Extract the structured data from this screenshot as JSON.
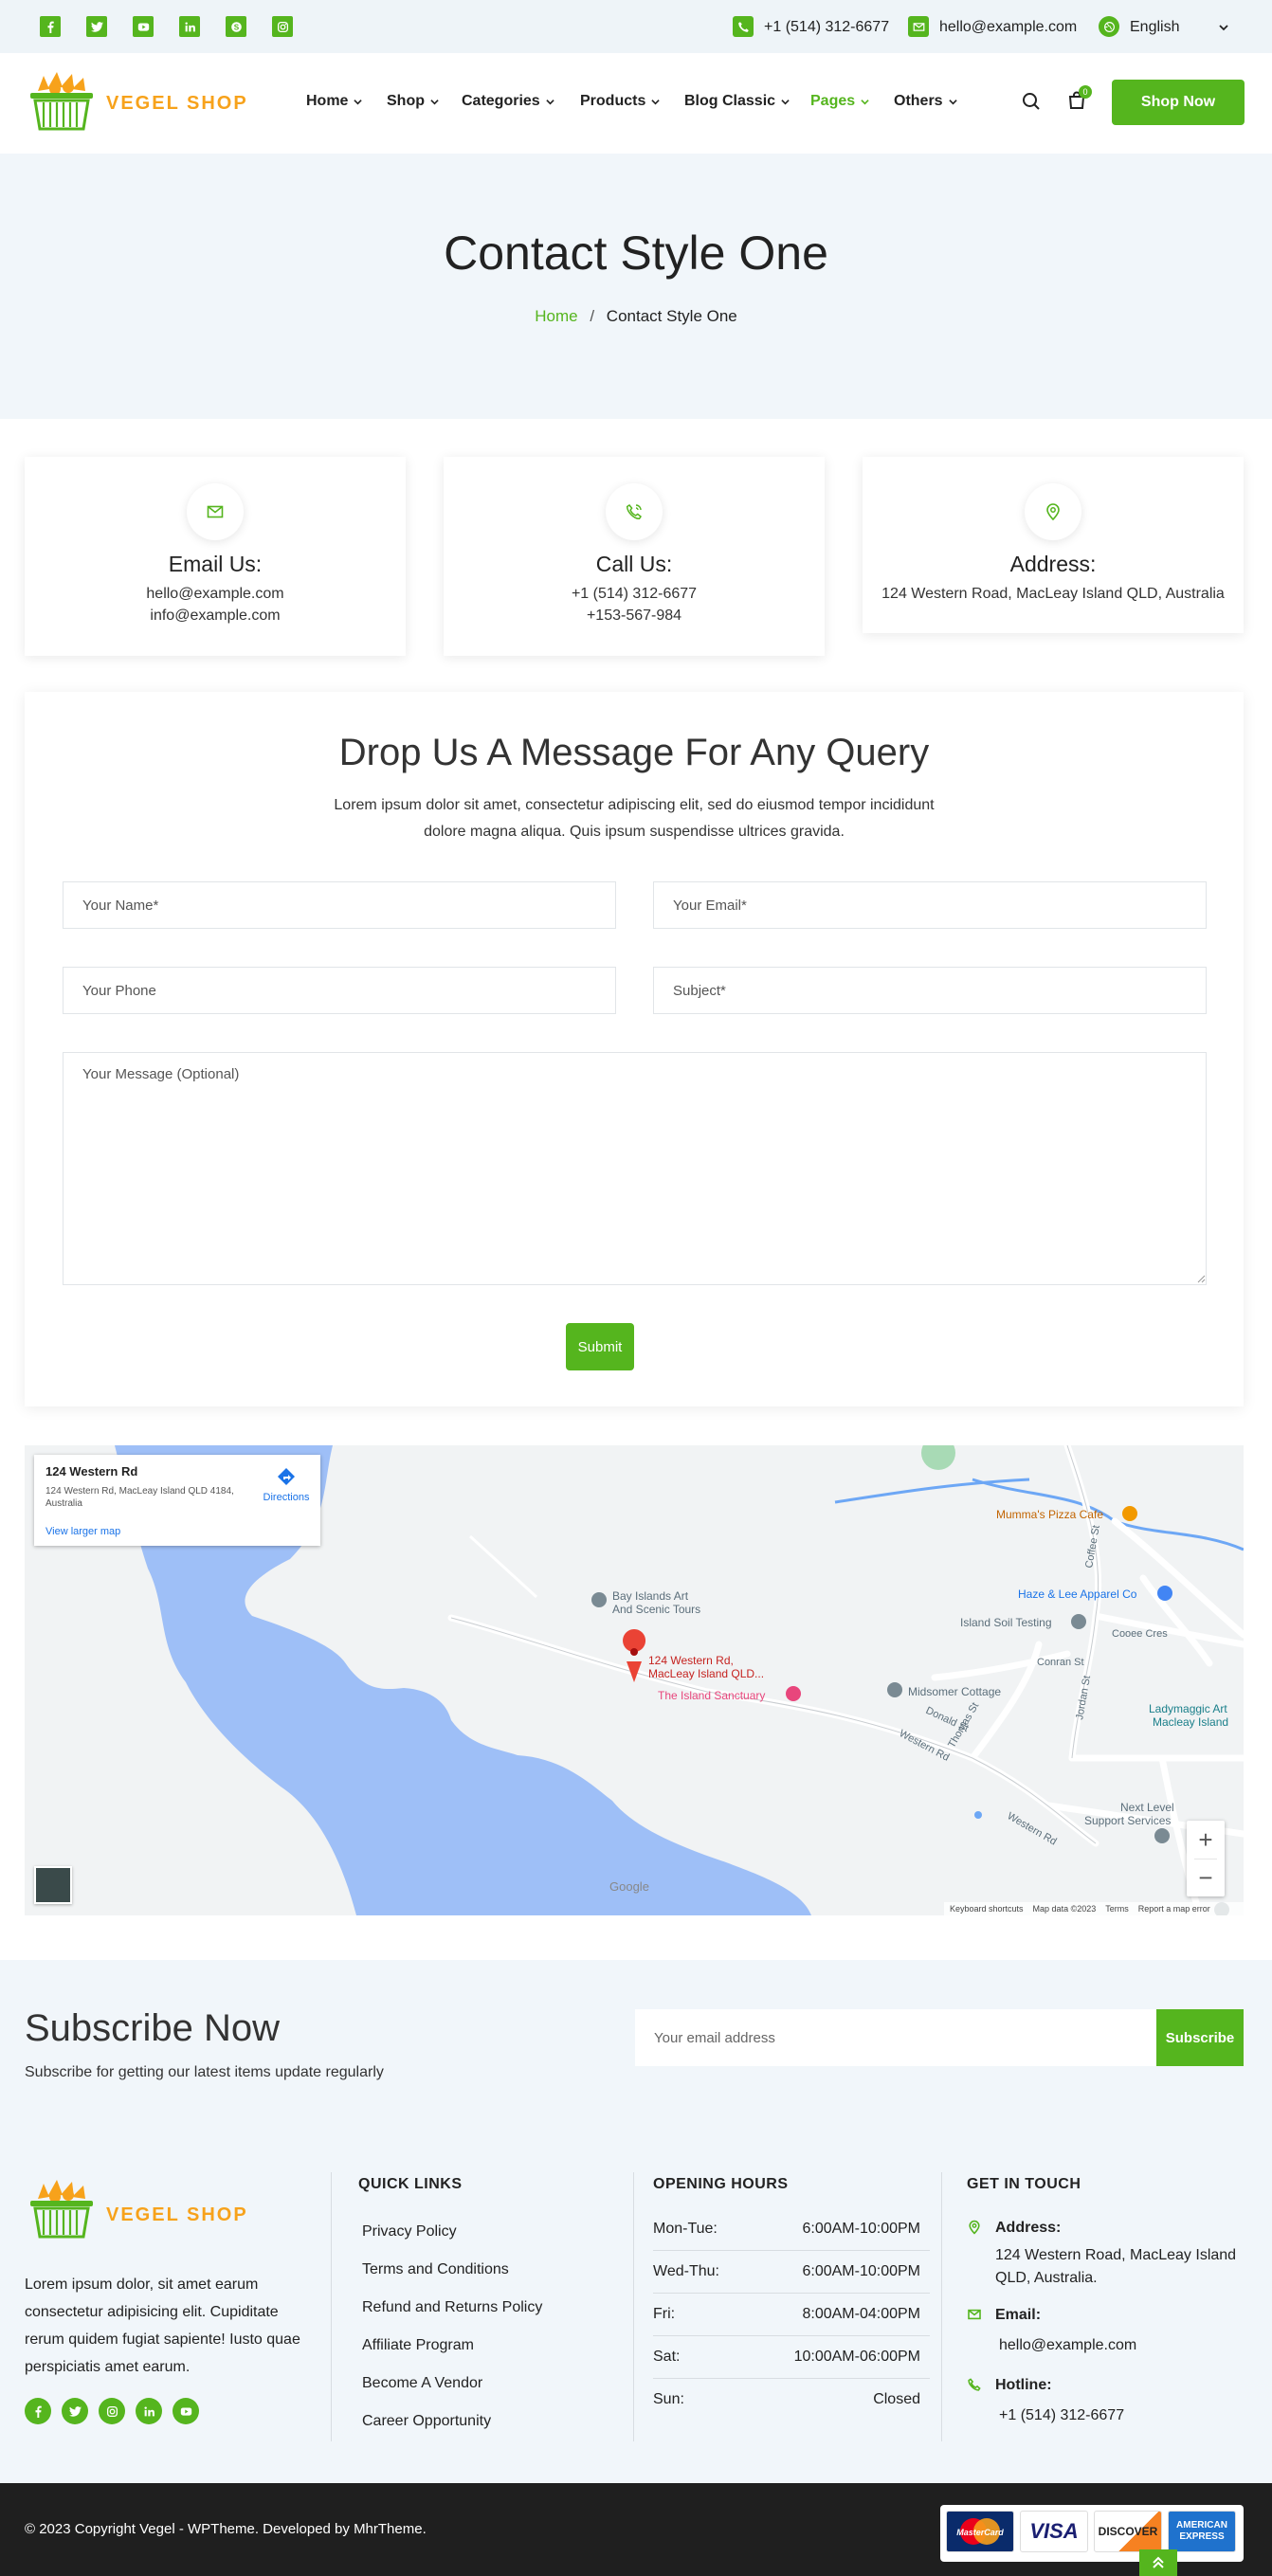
{
  "topbar": {
    "phone": "+1 (514) 312-6677",
    "email": "hello@example.com",
    "language": "English"
  },
  "header": {
    "brand": "VEGEL SHOP",
    "nav": [
      {
        "label": "Home",
        "active": false
      },
      {
        "label": "Shop",
        "active": false
      },
      {
        "label": "Categories",
        "active": false
      },
      {
        "label": "Products",
        "active": false
      },
      {
        "label": "Blog Classic",
        "active": false
      },
      {
        "label": "Pages",
        "active": true
      },
      {
        "label": "Others",
        "active": false
      }
    ],
    "cart_count": "0",
    "cta": "Shop Now"
  },
  "hero": {
    "title": "Contact Style One",
    "breadcrumb_home": "Home",
    "breadcrumb_sep": "/",
    "breadcrumb_current": "Contact Style One"
  },
  "info_cards": {
    "email": {
      "title": "Email Us:",
      "line1": "hello@example.com",
      "line2": "info@example.com"
    },
    "call": {
      "title": "Call Us:",
      "line1": "+1 (514) 312-6677",
      "line2": "+153-567-984"
    },
    "address": {
      "title": "Address:",
      "line1": "124 Western Road, MacLeay Island QLD, Australia"
    }
  },
  "form": {
    "title": "Drop Us A Message For Any Query",
    "description": "Lorem ipsum dolor sit amet, consectetur adipiscing elit, sed do eiusmod tempor incididunt dolore magna aliqua. Quis ipsum suspendisse ultrices gravida.",
    "name_placeholder": "Your Name*",
    "email_placeholder": "Your Email*",
    "phone_placeholder": "Your Phone",
    "subject_placeholder": "Subject*",
    "message_placeholder": "Your Message (Optional)",
    "submit": "Submit"
  },
  "map": {
    "place_title": "124 Western Rd",
    "place_address": "124 Western Rd, MacLeay Island QLD 4184, Australia",
    "directions": "Directions",
    "larger_map": "View larger map",
    "pin_label_1": "124 Western Rd,",
    "pin_label_2": "MacLeay Island QLD...",
    "labels": {
      "pizza": "Mumma's Pizza Cafe",
      "apparel": "Haze & Lee Apparel Co",
      "soil": "Island Soil Testing",
      "cooee": "Cooee Cres",
      "bay1": "Bay Islands Art",
      "bay2": "And Scenic Tours",
      "sanctuary": "The Island Sanctuary",
      "midsomer": "Midsomer Cottage",
      "lady1": "Ladymaggic Art",
      "lady2": "Macleay Island",
      "next1": "Next Level",
      "next2": "Support Services",
      "conran": "Conran St",
      "donald": "Donald St",
      "western": "Western Rd",
      "western2": "Western Rd",
      "thomas": "Thomas St",
      "jordan": "Jordan St",
      "coffee": "Coffee St"
    },
    "footer_shortcuts": "Keyboard shortcuts",
    "footer_data": "Map data ©2023",
    "footer_terms": "Terms",
    "footer_report": "Report a map error",
    "google": "Google"
  },
  "subscribe": {
    "title": "Subscribe Now",
    "subtitle": "Subscribe for getting our latest items update regularly",
    "placeholder": "Your email address",
    "button": "Subscribe"
  },
  "footer": {
    "about": "Lorem ipsum dolor, sit amet earum consectetur adipisicing elit. Cupiditate rerum quidem fugiat sapiente! Iusto quae perspiciatis amet earum.",
    "quick_links_title": "QUICK LINKS",
    "quick_links": [
      "Privacy Policy",
      "Terms and Conditions",
      "Refund and Returns Policy",
      "Affiliate Program",
      "Become A Vendor",
      "Career Opportunity"
    ],
    "hours_title": "OPENING HOURS",
    "hours": [
      {
        "day": "Mon-Tue:",
        "time": "6:00AM-10:00PM"
      },
      {
        "day": "Wed-Thu:",
        "time": "6:00AM-10:00PM"
      },
      {
        "day": "Fri:",
        "time": "8:00AM-04:00PM"
      },
      {
        "day": "Sat:",
        "time": "10:00AM-06:00PM"
      },
      {
        "day": "Sun:",
        "time": "Closed"
      }
    ],
    "touch_title": "GET IN TOUCH",
    "address_label": "Address:",
    "address_line1": "124 Western Road, MacLeay Island",
    "address_line2": "QLD, Australia.",
    "email_label": "Email:",
    "email_value": "hello@example.com",
    "hotline_label": "Hotline:",
    "hotline_value": "+1 (514) 312-6677",
    "copyright": "© 2023 Copyright Vegel - WPTheme. Developed by MhrTheme.",
    "payments": [
      "MasterCard",
      "VISA",
      "DISCOVER",
      "AMERICAN EXPRESS"
    ]
  },
  "colors": {
    "accent": "#55b51e",
    "brand": "#f7a21b",
    "dark": "#1f1f1f"
  }
}
